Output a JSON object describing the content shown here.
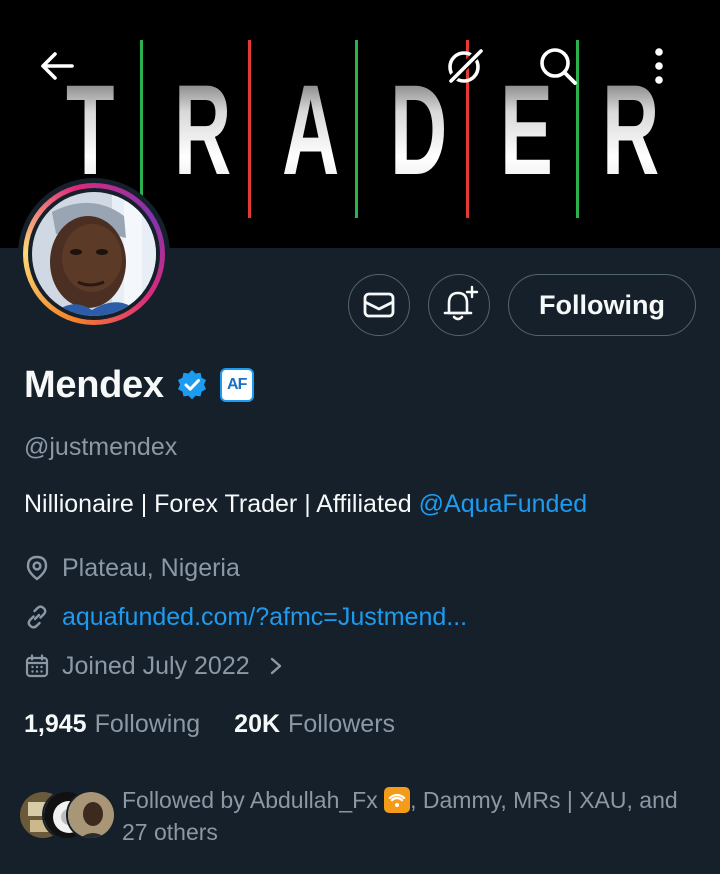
{
  "banner": {
    "letters": [
      "T",
      "R",
      "A",
      "D",
      "E",
      "R"
    ],
    "line_colors": [
      "#2bb24c",
      "#e53935",
      "#2bb24c",
      "#e53935",
      "#2bb24c",
      "#e53935",
      "#2bb24c",
      "#e53935",
      "#2bb24c"
    ]
  },
  "toolbar": {
    "back_icon": "arrow-left-icon",
    "grok_icon": "slash-circle-icon",
    "search_icon": "search-icon",
    "more_icon": "more-vertical-icon"
  },
  "profile": {
    "name": "Mendex",
    "verified": true,
    "affiliate_badge": "AF",
    "handle": "@justmendex",
    "bio_text": "Nillionaire | Forex Trader | Affiliated ",
    "bio_mention": "@AquaFunded",
    "location": "Plateau, Nigeria",
    "website": "aquafunded.com/?afmc=Justmend...",
    "joined": "Joined July 2022"
  },
  "actions": {
    "message_icon": "mail-icon",
    "notify_icon": "bell-plus-icon",
    "follow_label": "Following"
  },
  "stats": {
    "following_count": "1,945",
    "following_label": "Following",
    "followers_count": "20K",
    "followers_label": "Followers"
  },
  "followed_by": {
    "prefix": "Followed by Abdullah_Fx ",
    "suffix": ", Dammy, MRs | XAU, and",
    "line2": "27 others"
  },
  "colors": {
    "background": "#15202b",
    "accent": "#1d9bf0",
    "muted": "#8b98a5",
    "border": "#536471"
  }
}
